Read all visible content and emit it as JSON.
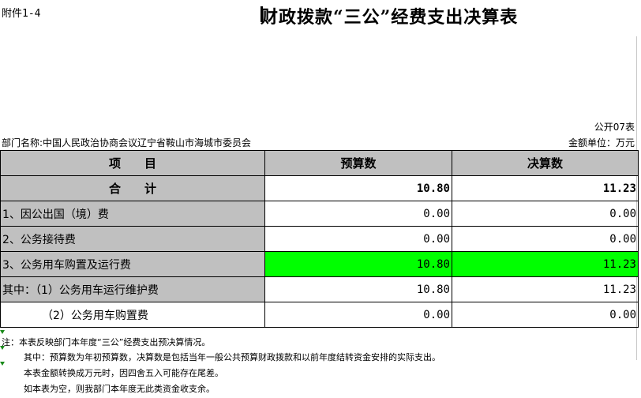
{
  "attachment": "附件1-4",
  "title": "财政拨款“三公”经费支出决算表",
  "form_no": "公开07表",
  "department": "部门名称:中国人民政治协商会议辽宁省鞍山市海城市委员会",
  "unit": "金额单位：万元",
  "header": {
    "item": "项　　目",
    "budget": "预算数",
    "final": "决算数"
  },
  "total": {
    "label": "合　　计",
    "budget": "10.80",
    "final": "11.23"
  },
  "rows": [
    {
      "label": "1、因公出国（境）费",
      "budget": "0.00",
      "final": "0.00"
    },
    {
      "label": "2、公务接待费",
      "budget": "0.00",
      "final": "0.00"
    },
    {
      "label": "3、公务用车购置及运行费",
      "budget": "10.80",
      "final": "11.23"
    },
    {
      "label": "其中：（1）公务用车运行维护费",
      "budget": "10.80",
      "final": "11.23"
    },
    {
      "label": "（2）公务用车购置费",
      "budget": "0.00",
      "final": "0.00"
    }
  ],
  "notes": [
    "注：本表反映部门本年度“三公”经费支出预决算情况。",
    "其中：预算数为年初预算数，决算数是包括当年一般公共预算财政拨款和以前年度结转资金安排的实际支出。",
    "本表金额转换成万元时，因四舍五入可能存在尾差。",
    "如本表为空，则我部门本年度无此类资金收支余。"
  ],
  "colors": {
    "header_gray": "#c0c0c0",
    "highlight": "#00ff00"
  }
}
